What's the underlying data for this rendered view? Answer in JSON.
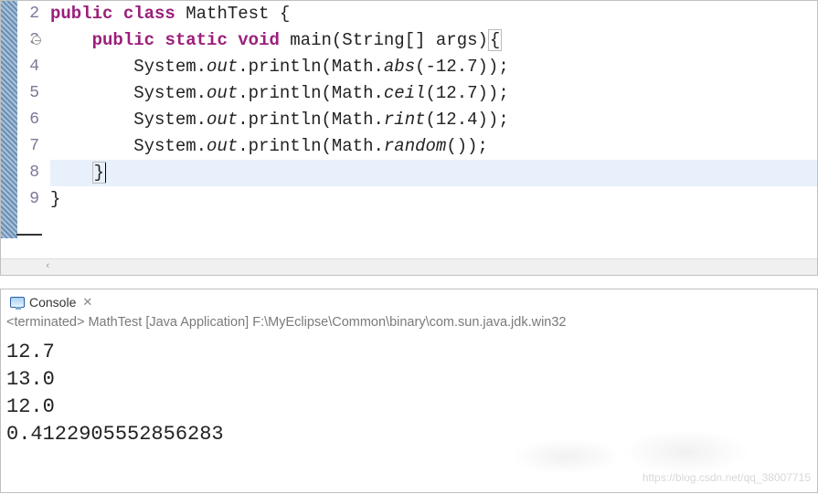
{
  "editor": {
    "line_numbers": [
      "2",
      "3",
      "4",
      "5",
      "6",
      "7",
      "8",
      "9"
    ],
    "override_marker_line": 1,
    "lines": [
      {
        "prefix": "",
        "tokens": [
          {
            "t": "public",
            "c": "kw"
          },
          {
            "t": " "
          },
          {
            "t": "class",
            "c": "kw"
          },
          {
            "t": " MathTest {"
          }
        ]
      },
      {
        "prefix": "    ",
        "tokens": [
          {
            "t": "public",
            "c": "kw"
          },
          {
            "t": " "
          },
          {
            "t": "static",
            "c": "kw"
          },
          {
            "t": " "
          },
          {
            "t": "void",
            "c": "kw"
          },
          {
            "t": " main(String[] args)"
          },
          {
            "t": "{",
            "c": "bracket-box"
          }
        ]
      },
      {
        "prefix": "        ",
        "tokens": [
          {
            "t": "System."
          },
          {
            "t": "out",
            "c": "it"
          },
          {
            "t": ".println(Math."
          },
          {
            "t": "abs",
            "c": "it"
          },
          {
            "t": "(-12.7));"
          }
        ]
      },
      {
        "prefix": "        ",
        "tokens": [
          {
            "t": "System."
          },
          {
            "t": "out",
            "c": "it"
          },
          {
            "t": ".println(Math."
          },
          {
            "t": "ceil",
            "c": "it"
          },
          {
            "t": "(12.7));"
          }
        ]
      },
      {
        "prefix": "        ",
        "tokens": [
          {
            "t": "System."
          },
          {
            "t": "out",
            "c": "it"
          },
          {
            "t": ".println(Math."
          },
          {
            "t": "rint",
            "c": "it"
          },
          {
            "t": "(12.4));"
          }
        ]
      },
      {
        "prefix": "        ",
        "tokens": [
          {
            "t": "System."
          },
          {
            "t": "out",
            "c": "it"
          },
          {
            "t": ".println(Math."
          },
          {
            "t": "random",
            "c": "it"
          },
          {
            "t": "());"
          }
        ]
      },
      {
        "prefix": "    ",
        "highlight": true,
        "caret_after": true,
        "tokens": [
          {
            "t": "}",
            "c": "bracket-box"
          }
        ]
      },
      {
        "prefix": "",
        "tokens": [
          {
            "t": "}"
          }
        ]
      }
    ]
  },
  "console": {
    "tab_label": "Console",
    "info": "<terminated> MathTest [Java Application] F:\\MyEclipse\\Common\\binary\\com.sun.java.jdk.win32",
    "output": [
      "12.7",
      "13.0",
      "12.0",
      "0.4122905552856283"
    ]
  },
  "watermark": "https://blog.csdn.net/qq_38007715"
}
